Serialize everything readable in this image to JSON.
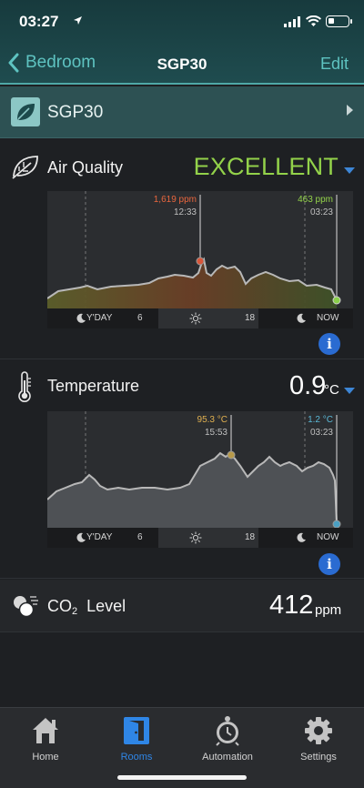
{
  "status_bar": {
    "time": "03:27"
  },
  "nav": {
    "back_label": "Bedroom",
    "title": "SGP30",
    "edit_label": "Edit"
  },
  "device": {
    "name": "SGP30"
  },
  "air_quality": {
    "label": "Air Quality",
    "value": "EXCELLENT",
    "value_color": "#93d24a",
    "peak": {
      "value": "1,619 ppm",
      "time": "12:33",
      "color": "#e8663e"
    },
    "current": {
      "value": "463 ppm",
      "time": "03:23",
      "color": "#93d24a"
    }
  },
  "temperature": {
    "label": "Temperature",
    "value": "0.9",
    "unit": "°C",
    "peak": {
      "value": "95.3 °C",
      "time": "15:53",
      "color": "#e0b050"
    },
    "current": {
      "value": "1.2 °C",
      "time": "03:23",
      "color": "#5ab8d6"
    }
  },
  "co2": {
    "label_main": "CO",
    "label_sub": "2",
    "label_rest": "Level",
    "value": "412",
    "unit": "ppm"
  },
  "timeline": {
    "yday": "Y'DAY",
    "six": "6",
    "eighteen": "18",
    "now": "NOW"
  },
  "tabs": [
    {
      "label": "Home",
      "icon": "home-icon"
    },
    {
      "label": "Rooms",
      "icon": "rooms-door-icon"
    },
    {
      "label": "Automation",
      "icon": "automation-clock-icon"
    },
    {
      "label": "Settings",
      "icon": "settings-gear-icon"
    }
  ],
  "colors": {
    "accent": "#5ec3c1",
    "active_tab": "#2f86e6",
    "info": "#2a6bd1"
  }
}
